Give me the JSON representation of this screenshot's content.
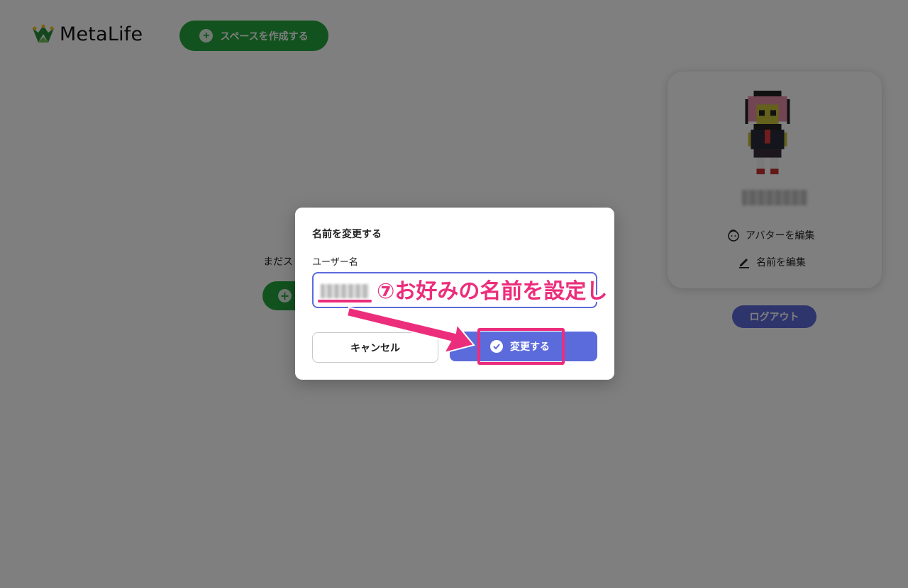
{
  "app": {
    "logo_text": "MetaLife"
  },
  "header": {
    "create_space_label": "スペースを作成する"
  },
  "main": {
    "empty_text": "まだス"
  },
  "profile": {
    "edit_avatar_label": "アバターを編集",
    "edit_name_label": "名前を編集",
    "logout_label": "ログアウト"
  },
  "dialog": {
    "title": "名前を変更する",
    "field_label": "ユーザー名",
    "cancel_label": "キャンセル",
    "confirm_label": "変更する"
  },
  "annotation": {
    "text": "⑦お好みの名前を設定し"
  },
  "colors": {
    "brand_green": "#24a53c",
    "primary": "#5c6bdb",
    "annotation_pink": "#ec2d7b",
    "overlay": "rgba(0,0,0,0.5)"
  },
  "icons": {
    "logo": "metalife-logo-icon",
    "plus": "plus-circle-icon",
    "avatar_edit": "face-icon",
    "name_edit": "pencil-icon",
    "confirm": "check-circle-icon"
  }
}
